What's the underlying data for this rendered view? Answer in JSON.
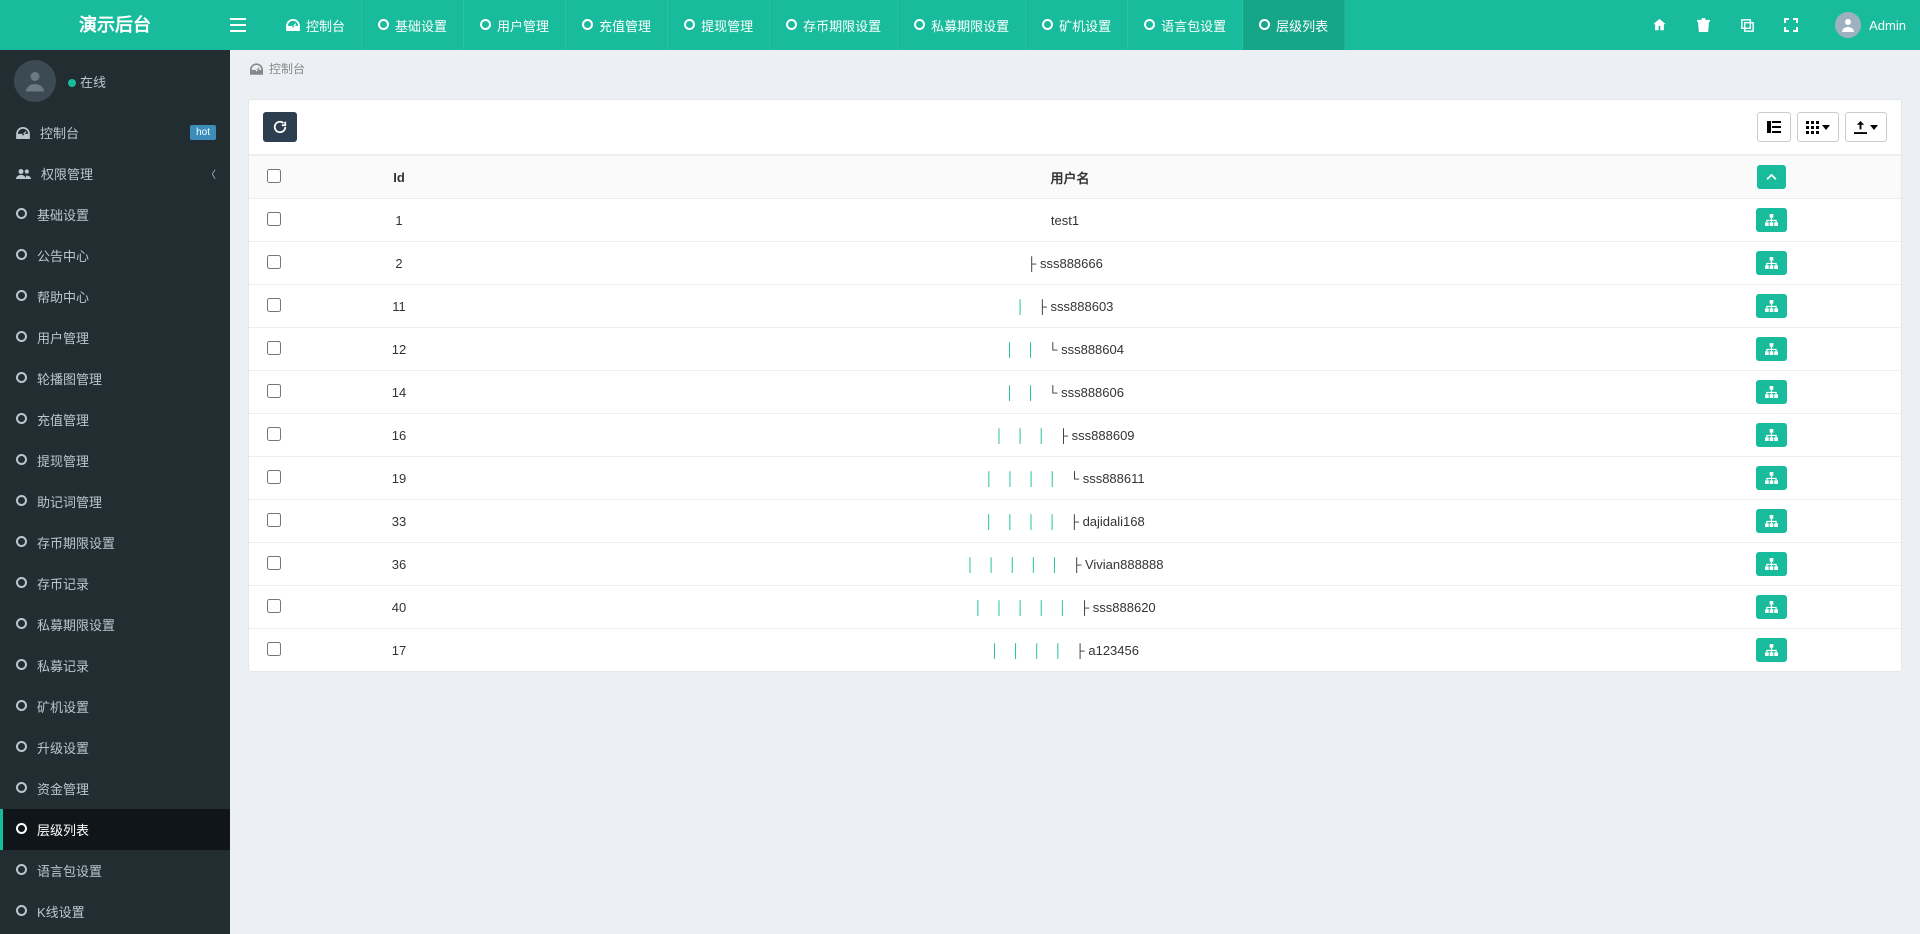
{
  "brand": "演示后台",
  "user": {
    "name": "Admin",
    "status": "在线"
  },
  "topnav": [
    {
      "key": "console",
      "label": "控制台",
      "icon": "dashboard"
    },
    {
      "key": "basic",
      "label": "基础设置",
      "icon": "circle"
    },
    {
      "key": "users",
      "label": "用户管理",
      "icon": "circle"
    },
    {
      "key": "recharge",
      "label": "充值管理",
      "icon": "circle"
    },
    {
      "key": "withdraw",
      "label": "提现管理",
      "icon": "circle"
    },
    {
      "key": "deposit",
      "label": "存币期限设置",
      "icon": "circle"
    },
    {
      "key": "private",
      "label": "私募期限设置",
      "icon": "circle"
    },
    {
      "key": "miner",
      "label": "矿机设置",
      "icon": "circle"
    },
    {
      "key": "lang",
      "label": "语言包设置",
      "icon": "circle"
    },
    {
      "key": "level",
      "label": "层级列表",
      "icon": "circle",
      "active": true
    }
  ],
  "breadcrumb": {
    "label": "控制台"
  },
  "sidebar": [
    {
      "label": "控制台",
      "icon": "dashboard",
      "badge": "hot"
    },
    {
      "label": "权限管理",
      "icon": "users",
      "chev": true
    },
    {
      "label": "基础设置",
      "icon": "circle"
    },
    {
      "label": "公告中心",
      "icon": "circle"
    },
    {
      "label": "帮助中心",
      "icon": "circle"
    },
    {
      "label": "用户管理",
      "icon": "circle"
    },
    {
      "label": "轮播图管理",
      "icon": "circle"
    },
    {
      "label": "充值管理",
      "icon": "circle"
    },
    {
      "label": "提现管理",
      "icon": "circle"
    },
    {
      "label": "助记词管理",
      "icon": "circle"
    },
    {
      "label": "存币期限设置",
      "icon": "circle"
    },
    {
      "label": "存币记录",
      "icon": "circle"
    },
    {
      "label": "私募期限设置",
      "icon": "circle"
    },
    {
      "label": "私募记录",
      "icon": "circle"
    },
    {
      "label": "矿机设置",
      "icon": "circle"
    },
    {
      "label": "升级设置",
      "icon": "circle"
    },
    {
      "label": "资金管理",
      "icon": "circle"
    },
    {
      "label": "层级列表",
      "icon": "circle",
      "active": true
    },
    {
      "label": "语言包设置",
      "icon": "circle"
    },
    {
      "label": "K线设置",
      "icon": "circle"
    }
  ],
  "table": {
    "columns": {
      "id": "Id",
      "username": "用户名"
    },
    "rows": [
      {
        "id": "1",
        "indent": 0,
        "glyph": "",
        "name": "test1"
      },
      {
        "id": "2",
        "indent": 1,
        "glyph": "├",
        "name": "sss888666"
      },
      {
        "id": "11",
        "indent": 2,
        "glyph": "├",
        "name": "sss888603"
      },
      {
        "id": "12",
        "indent": 3,
        "glyph": "└",
        "name": "sss888604"
      },
      {
        "id": "14",
        "indent": 3,
        "glyph": "└",
        "name": "sss888606"
      },
      {
        "id": "16",
        "indent": 4,
        "glyph": "├",
        "name": "sss888609"
      },
      {
        "id": "19",
        "indent": 5,
        "glyph": "└",
        "name": "sss888611"
      },
      {
        "id": "33",
        "indent": 5,
        "glyph": "├",
        "name": "dajidali168"
      },
      {
        "id": "36",
        "indent": 6,
        "glyph": "├",
        "name": "Vivian888888"
      },
      {
        "id": "40",
        "indent": 6,
        "glyph": "├",
        "name": "sss888620"
      },
      {
        "id": "17",
        "indent": 5,
        "glyph": "├",
        "name": "a123456"
      }
    ]
  }
}
